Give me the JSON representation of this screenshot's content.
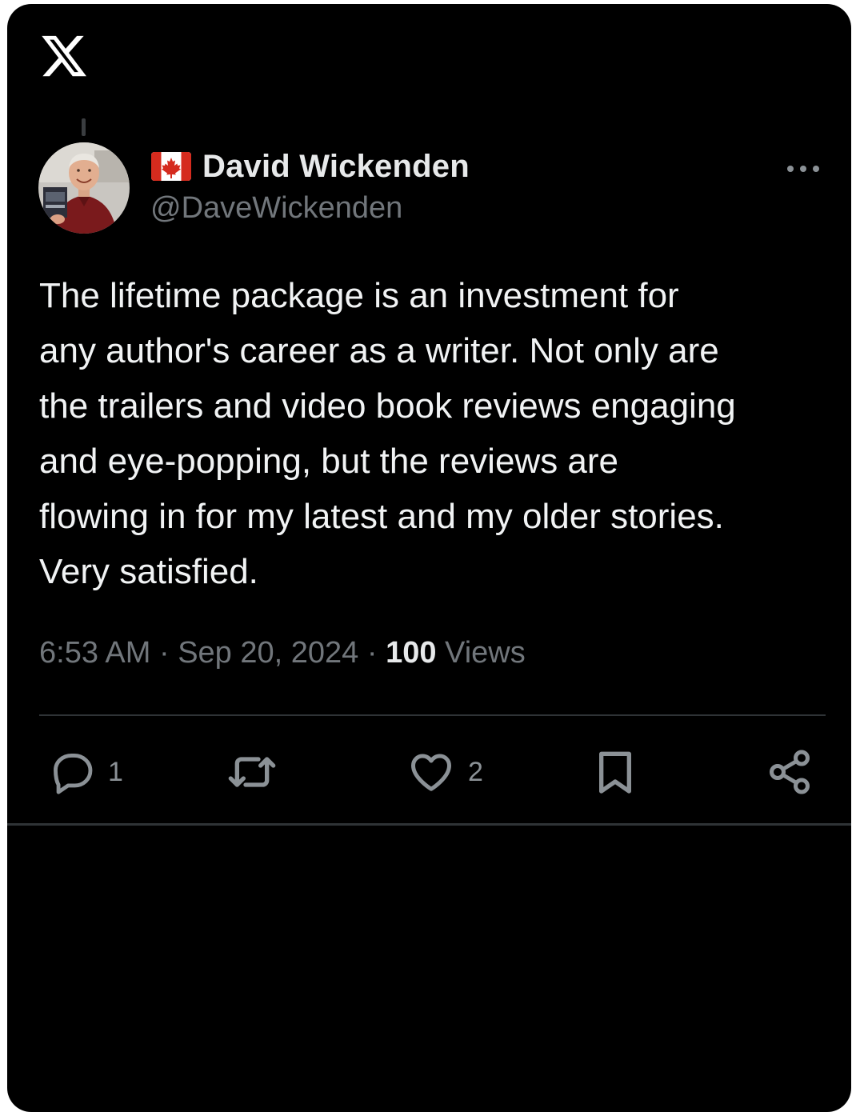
{
  "app": {
    "logo": "x-logo-icon"
  },
  "author": {
    "display_name": "David Wickenden",
    "handle": "@DaveWickenden",
    "flag": "canada-flag-icon",
    "avatar": "avatar-photo"
  },
  "post": {
    "text": "The lifetime package is an investment for\nany author's career as a writer. Not only are\nthe trailers and video book reviews engaging\nand eye-popping, but the reviews are\nflowing in for my latest and my older stories.\nVery satisfied.",
    "time": "6:53 AM",
    "separator": " · ",
    "date": "Sep 20, 2024",
    "views_count": "100",
    "views_label": "Views"
  },
  "actions": {
    "reply_count": "1",
    "like_count": "2",
    "icons": [
      "reply-icon",
      "repost-icon",
      "like-icon",
      "bookmark-icon",
      "share-icon"
    ]
  },
  "colors": {
    "background": "#000000",
    "text_primary": "#e7e9ea",
    "text_secondary": "#71767b",
    "divider": "#2f3336",
    "flag_red": "#d52b1e"
  }
}
